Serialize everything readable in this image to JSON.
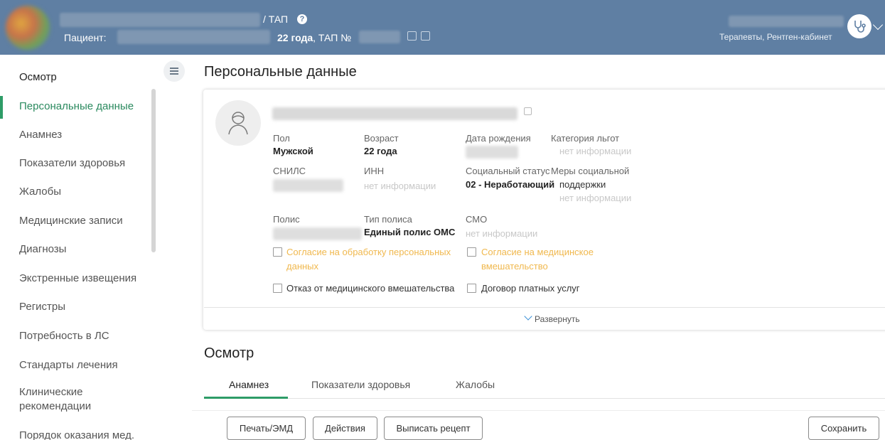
{
  "header": {
    "title": "/ ТАП",
    "patient_label": "Пациент:",
    "age": "22 года",
    "tap_label": ", ТАП №",
    "department": "Терапевты, Рентген-кабинет"
  },
  "sidebar": {
    "items": [
      {
        "label": "Осмотр"
      },
      {
        "label": "Персональные данные"
      },
      {
        "label": "Анамнез"
      },
      {
        "label": "Показатели здоровья"
      },
      {
        "label": "Жалобы"
      },
      {
        "label": "Медицинские записи"
      },
      {
        "label": "Диагнозы"
      },
      {
        "label": "Экстренные извещения"
      },
      {
        "label": "Регистры"
      },
      {
        "label": "Потребность в ЛС"
      },
      {
        "label": "Стандарты лечения"
      },
      {
        "label": "Клинические рекомендации"
      },
      {
        "label": "Порядок оказания мед."
      }
    ]
  },
  "personal": {
    "title": "Персональные данные",
    "fields": {
      "sex_label": "Пол",
      "sex_value": "Мужской",
      "age_label": "Возраст",
      "age_value": "22 года",
      "dob_label": "Дата рождения",
      "benefit_label": "Категория льгот",
      "benefit_value": "нет информации",
      "snils_label": "СНИЛС",
      "inn_label": "ИНН",
      "inn_value": "нет информации",
      "social_label": "Социальный статус",
      "social_value": "02 - Неработающий",
      "support_label_1": "Меры социальной",
      "support_label_2": "поддержки",
      "support_value": "нет информации",
      "policy_label": "Полис",
      "policy_type_label": "Тип полиса",
      "policy_type_value": "Единый полис ОМС",
      "smo_label": "СМО",
      "smo_value": "нет информации"
    },
    "checks": {
      "consent_personal_1": "Согласие на обработку персональных",
      "consent_personal_2": "данных",
      "consent_medical_1": "Согласие на медицинское",
      "consent_medical_2": "вмешательство",
      "refusal": "Отказ от медицинского вмешательства",
      "paid_contract": "Договор платных услуг"
    },
    "expand_label": "Развернуть"
  },
  "exam": {
    "title": "Осмотр",
    "tabs": [
      {
        "label": "Анамнез"
      },
      {
        "label": "Показатели здоровья"
      },
      {
        "label": "Жалобы"
      }
    ]
  },
  "buttons": {
    "print": "Печать/ЭМД",
    "actions": "Действия",
    "prescription": "Выписать рецепт",
    "save": "Сохранить"
  },
  "colors": {
    "header_bg": "#5f7fa3",
    "accent_green": "#2e9c67",
    "warning_orange": "#f0b84e",
    "muted_text": "#c8c8c8"
  }
}
